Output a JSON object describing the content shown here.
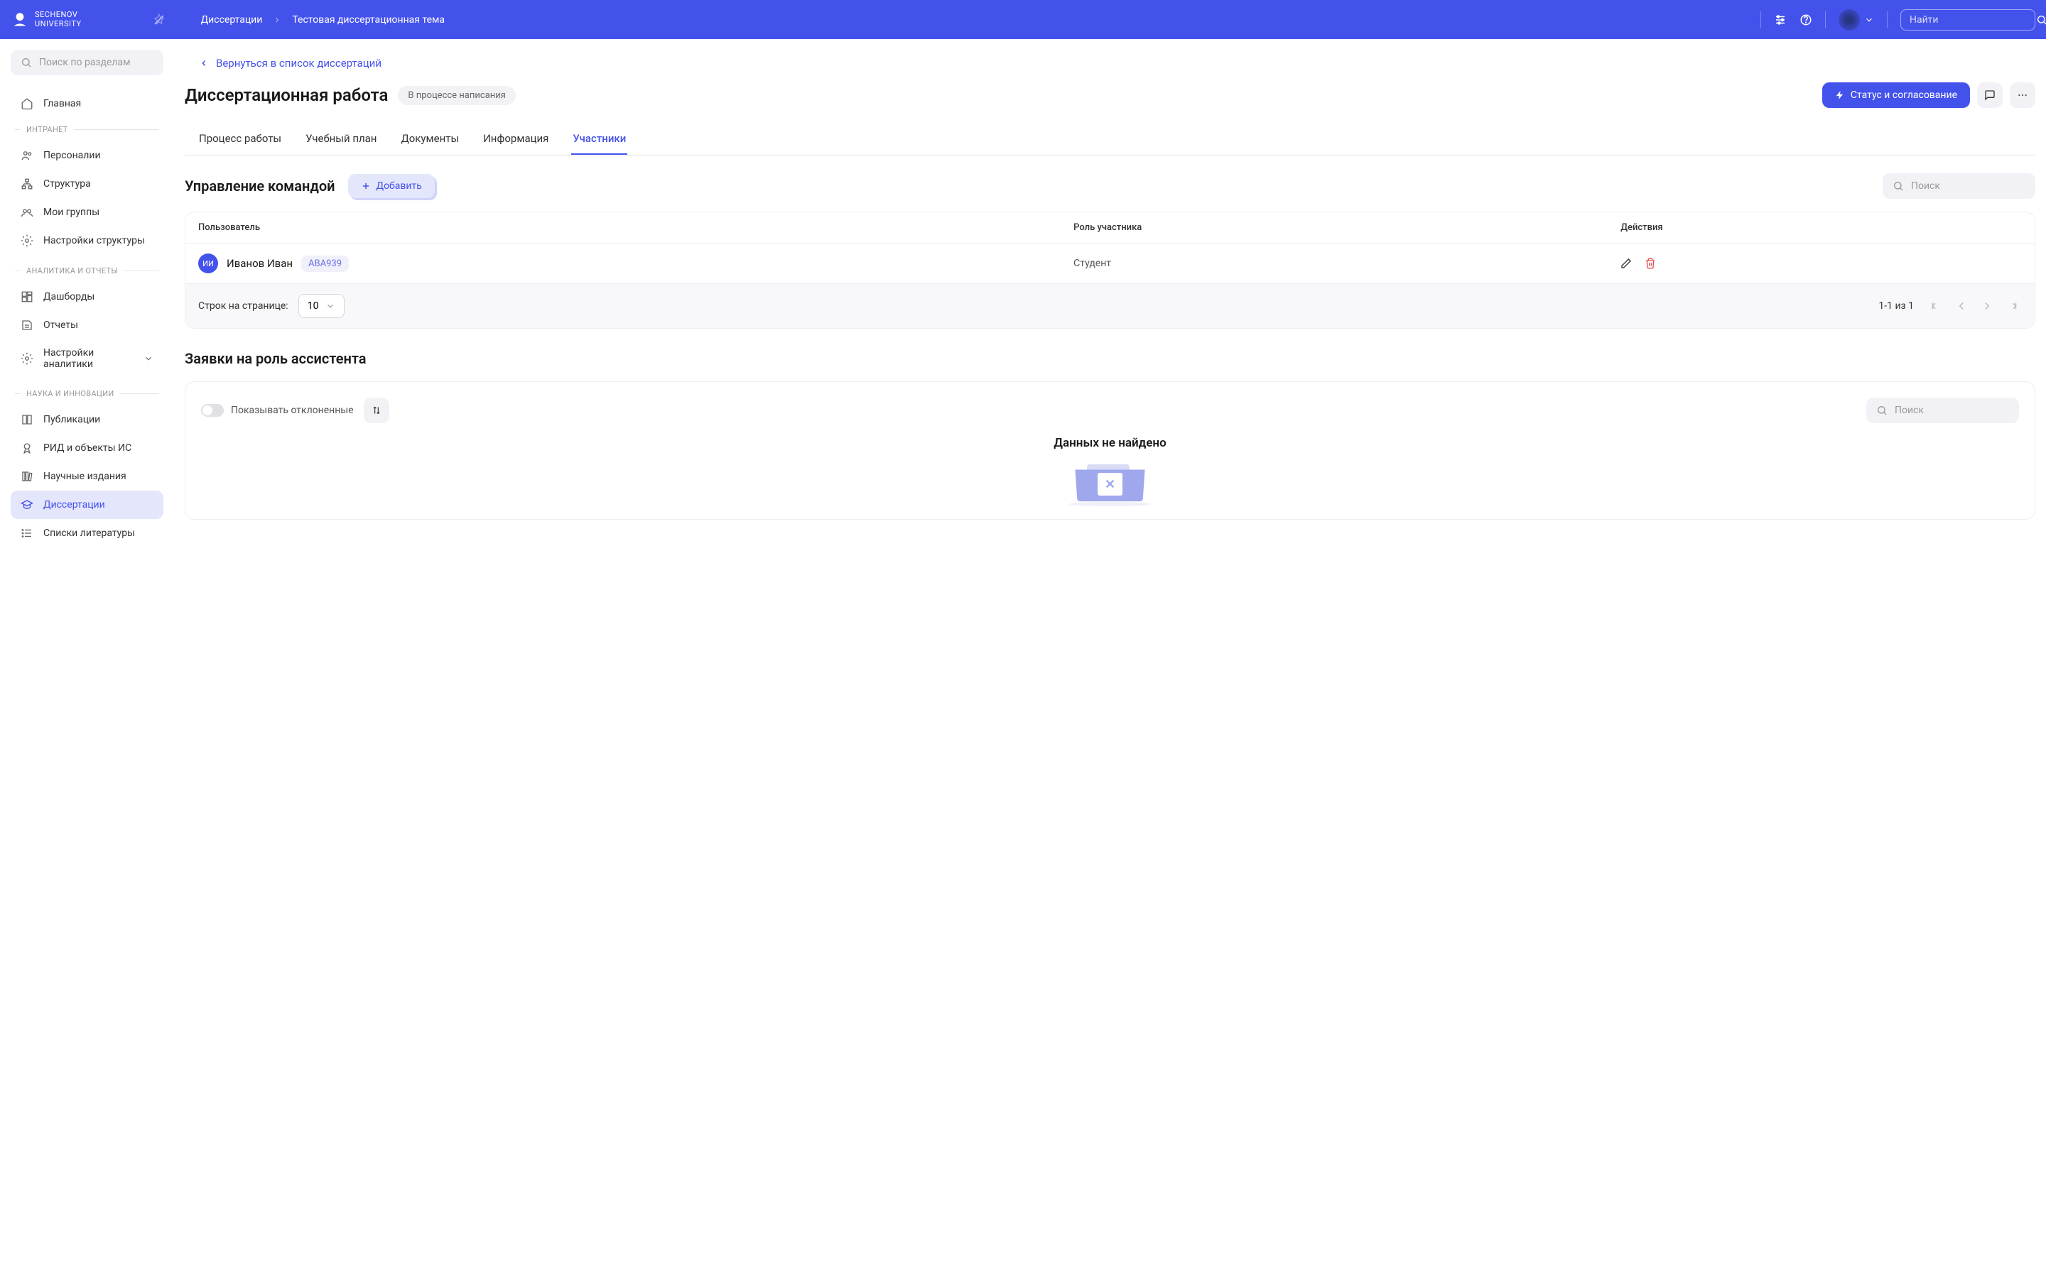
{
  "header": {
    "logo_line1": "SECHENOV",
    "logo_line2": "UNIVERSITY",
    "breadcrumb": {
      "parent": "Диссертации",
      "current": "Тестовая диссертационная тема"
    },
    "search_placeholder": "Найти"
  },
  "sidebar": {
    "search_placeholder": "Поиск по разделам",
    "main_item": "Главная",
    "sections": [
      {
        "title": "ИНТРАНЕТ",
        "items": [
          {
            "label": "Персоналии",
            "icon": "users"
          },
          {
            "label": "Структура",
            "icon": "structure"
          },
          {
            "label": "Мои группы",
            "icon": "groups"
          },
          {
            "label": "Настройки структуры",
            "icon": "gear"
          }
        ]
      },
      {
        "title": "АНАЛИТИКА И ОТЧЕТЫ",
        "items": [
          {
            "label": "Дашборды",
            "icon": "dashboard"
          },
          {
            "label": "Отчеты",
            "icon": "report"
          },
          {
            "label": "Настройки аналитики",
            "icon": "gear",
            "expandable": true
          }
        ]
      },
      {
        "title": "НАУКА И ИННОВАЦИИ",
        "items": [
          {
            "label": "Публикации",
            "icon": "book"
          },
          {
            "label": "РИД и объекты ИС",
            "icon": "award"
          },
          {
            "label": "Научные издания",
            "icon": "library"
          },
          {
            "label": "Диссертации",
            "icon": "graduation",
            "active": true
          },
          {
            "label": "Списки литературы",
            "icon": "list"
          }
        ]
      }
    ]
  },
  "content": {
    "back_text": "Вернуться в список диссертаций",
    "title": "Диссертационная работа",
    "status": "В процессе написания",
    "status_btn": "Статус и согласование",
    "tabs": [
      "Процесс работы",
      "Учебный план",
      "Документы",
      "Информация",
      "Участники"
    ],
    "active_tab_index": 4,
    "team": {
      "title": "Управление командой",
      "add_btn": "Добавить",
      "search_placeholder": "Поиск",
      "columns": {
        "user": "Пользователь",
        "role": "Роль участника",
        "actions": "Действия"
      },
      "rows": [
        {
          "initials": "ИИ",
          "name": "Иванов Иван",
          "code": "ABA939",
          "role": "Студент"
        }
      ],
      "rows_per_page_label": "Строк на странице:",
      "rows_per_page": "10",
      "page_info": "1-1 из 1"
    },
    "requests": {
      "title": "Заявки на роль ассистента",
      "toggle_label": "Показывать отклоненные",
      "search_placeholder": "Поиск",
      "empty_text": "Данных не найдено"
    }
  }
}
